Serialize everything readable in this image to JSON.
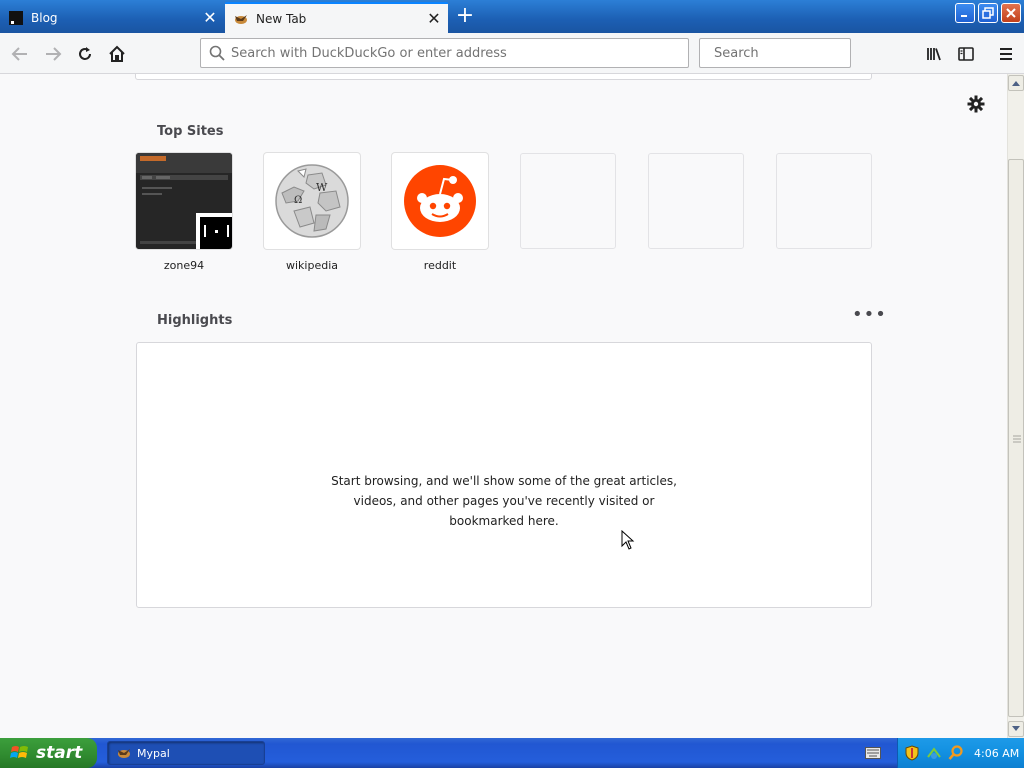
{
  "window": {
    "tabs": [
      {
        "title": "Blog",
        "active": false
      },
      {
        "title": "New Tab",
        "active": true
      }
    ],
    "new_tab_label": "+"
  },
  "toolbar": {
    "url_placeholder": "Search with DuckDuckGo or enter address",
    "search_placeholder": "Search"
  },
  "newtab": {
    "top_sites_title": "Top Sites",
    "top_sites": [
      {
        "label": "zone94"
      },
      {
        "label": "wikipedia"
      },
      {
        "label": "reddit"
      },
      {
        "label": ""
      },
      {
        "label": ""
      },
      {
        "label": ""
      }
    ],
    "highlights_title": "Highlights",
    "highlights_menu": "•••",
    "highlights_empty_message": "Start browsing, and we'll show some of the great articles, videos, and other pages you've recently visited or bookmarked here."
  },
  "taskbar": {
    "start_label": "start",
    "tasks": [
      {
        "label": "Mypal"
      }
    ],
    "clock": "4:06 AM"
  },
  "colors": {
    "reddit_orange": "#ff4500",
    "accent_blue": "#0a84ff",
    "xp_taskbar": "#245edb"
  }
}
